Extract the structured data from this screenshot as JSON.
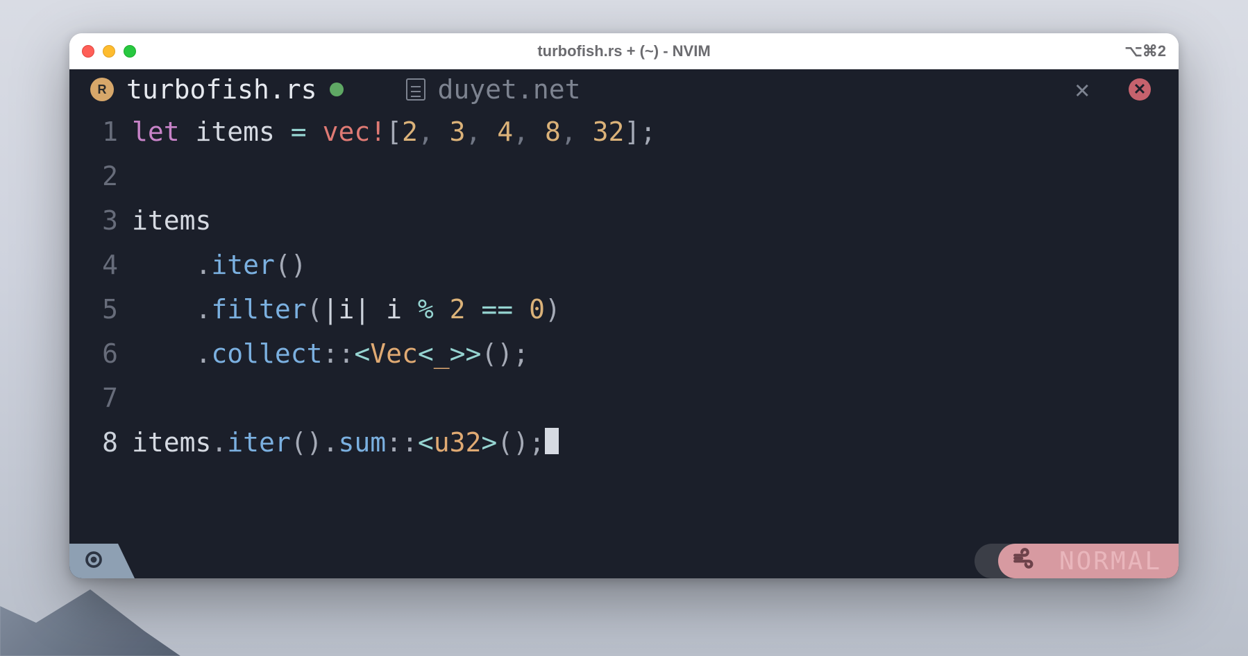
{
  "window": {
    "title": "turbofish.rs + (~) - NVIM",
    "shortcut": "⌥⌘2"
  },
  "tabs": {
    "active": {
      "icon": "rust-icon",
      "label": "turbofish.rs",
      "modified": true
    },
    "inactive": {
      "icon": "file-icon",
      "label": "duyet.net"
    }
  },
  "code": {
    "lines": [
      {
        "num": "1",
        "tokens": [
          {
            "t": "let ",
            "c": "tk-kw"
          },
          {
            "t": "items ",
            "c": "tk-id"
          },
          {
            "t": "= ",
            "c": "tk-op"
          },
          {
            "t": "vec!",
            "c": "tk-macro"
          },
          {
            "t": "[",
            "c": "tk-punc"
          },
          {
            "t": "2",
            "c": "tk-num"
          },
          {
            "t": ", ",
            "c": "tk-sep"
          },
          {
            "t": "3",
            "c": "tk-num"
          },
          {
            "t": ", ",
            "c": "tk-sep"
          },
          {
            "t": "4",
            "c": "tk-num"
          },
          {
            "t": ", ",
            "c": "tk-sep"
          },
          {
            "t": "8",
            "c": "tk-num"
          },
          {
            "t": ", ",
            "c": "tk-sep"
          },
          {
            "t": "32",
            "c": "tk-num"
          },
          {
            "t": "];",
            "c": "tk-punc"
          }
        ]
      },
      {
        "num": "2",
        "tokens": []
      },
      {
        "num": "3",
        "tokens": [
          {
            "t": "items",
            "c": "tk-id"
          }
        ]
      },
      {
        "num": "4",
        "tokens": [
          {
            "t": "    ",
            "c": ""
          },
          {
            "t": ".",
            "c": "tk-punc"
          },
          {
            "t": "iter",
            "c": "tk-fn"
          },
          {
            "t": "()",
            "c": "tk-punc"
          }
        ]
      },
      {
        "num": "5",
        "tokens": [
          {
            "t": "    ",
            "c": ""
          },
          {
            "t": ".",
            "c": "tk-punc"
          },
          {
            "t": "filter",
            "c": "tk-fn"
          },
          {
            "t": "(",
            "c": "tk-punc"
          },
          {
            "t": "|",
            "c": "tk-lamb"
          },
          {
            "t": "i",
            "c": "tk-id"
          },
          {
            "t": "|",
            "c": "tk-lamb"
          },
          {
            "t": " i ",
            "c": "tk-id"
          },
          {
            "t": "% ",
            "c": "tk-op"
          },
          {
            "t": "2 ",
            "c": "tk-num"
          },
          {
            "t": "== ",
            "c": "tk-op"
          },
          {
            "t": "0",
            "c": "tk-num"
          },
          {
            "t": ")",
            "c": "tk-punc"
          }
        ]
      },
      {
        "num": "6",
        "tokens": [
          {
            "t": "    ",
            "c": ""
          },
          {
            "t": ".",
            "c": "tk-punc"
          },
          {
            "t": "collect",
            "c": "tk-fn"
          },
          {
            "t": "::",
            "c": "tk-punc"
          },
          {
            "t": "<",
            "c": "tk-op"
          },
          {
            "t": "Vec",
            "c": "tk-ty"
          },
          {
            "t": "<",
            "c": "tk-op"
          },
          {
            "t": "_",
            "c": "tk-ty"
          },
          {
            "t": ">>",
            "c": "tk-op"
          },
          {
            "t": "();",
            "c": "tk-punc"
          }
        ]
      },
      {
        "num": "7",
        "tokens": []
      },
      {
        "num": "8",
        "current": true,
        "tokens": [
          {
            "t": "items",
            "c": "tk-id"
          },
          {
            "t": ".",
            "c": "tk-punc"
          },
          {
            "t": "iter",
            "c": "tk-fn"
          },
          {
            "t": "()",
            "c": "tk-punc"
          },
          {
            "t": ".",
            "c": "tk-punc"
          },
          {
            "t": "sum",
            "c": "tk-fn"
          },
          {
            "t": "::",
            "c": "tk-punc"
          },
          {
            "t": "<",
            "c": "tk-op"
          },
          {
            "t": "u32",
            "c": "tk-ty"
          },
          {
            "t": ">",
            "c": "tk-op"
          },
          {
            "t": "();",
            "c": "tk-punc"
          }
        ],
        "cursor": true
      }
    ]
  },
  "status": {
    "mode": "NORMAL"
  }
}
